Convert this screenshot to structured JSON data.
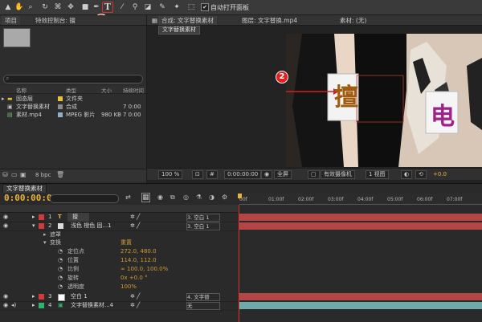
{
  "toolbar": {
    "auto_open_label": "自动打开面板",
    "checkbox_checked": "✔"
  },
  "markers": {
    "m1": "1",
    "m2": "2"
  },
  "project_panel": {
    "tab_project": "项目",
    "tab_effects": "特效控制台: 擅",
    "columns": {
      "name": "名称",
      "type": "类型",
      "size": "大小",
      "duration": "持续时间"
    },
    "items": [
      {
        "name": "固态层",
        "type": "文件夹",
        "size": "",
        "duration": "",
        "color": "#e6c23a"
      },
      {
        "name": "文字替换素材",
        "type": "合成",
        "size": "",
        "duration": "7 0:00",
        "color": "#8a8a8a"
      },
      {
        "name": "素材.mp4",
        "type": "MPEG 影片",
        "size": "980 KB",
        "duration": "7 0:00",
        "color": "#8fb0c9"
      }
    ],
    "bpc": "8 bpc"
  },
  "viewer": {
    "comp_tab": "合成: 文字替换素材",
    "layer_tab": "图层: 文字替换.mp4",
    "footage_tab": "素材: (无)",
    "subtab": "文字替换素材",
    "card_left": "擅",
    "card_right": "电",
    "zoom": "100 %",
    "resolution": "全屏",
    "camera": "有效摄像机",
    "views": "1 视图",
    "exposure": "+0.0"
  },
  "timeline": {
    "tab": "文字替换素材",
    "timecode": "0:00:00:00",
    "ruler_ticks": [
      "00f",
      "01:00f",
      "02:00f",
      "03:00f",
      "04:00f",
      "05:00f",
      "06:00f",
      "07:00f"
    ],
    "layers": [
      {
        "num": "1",
        "name": "擅",
        "parent": "3. 空白 1",
        "label_color": "#d03a3a",
        "bar_color": "#b44646"
      },
      {
        "num": "2",
        "name": "浅色 橙色 固...1",
        "parent": "3. 空白 1",
        "label_color": "#d03a3a",
        "bar_color": "#b44646"
      }
    ],
    "masks_label": "遮罩",
    "transform_label": "变换",
    "reset_label": "重置",
    "props": [
      {
        "name": "定位点",
        "value": "272.0, 480.0"
      },
      {
        "name": "位置",
        "value": "114.0, 112.0"
      },
      {
        "name": "比例",
        "value": "∞ 100.0, 100.0%"
      },
      {
        "name": "旋转",
        "value": "0x +0.0 °"
      },
      {
        "name": "透明度",
        "value": "100%"
      }
    ],
    "bottom_layers": [
      {
        "num": "3",
        "name": "空白 1",
        "parent": "4. 文字替",
        "label_color": "#d03a3a",
        "bar_color": "#b44646"
      },
      {
        "num": "4",
        "name": "文字替换素材...4",
        "parent": "无",
        "label_color": "#2db36b",
        "bar_color": "#6fa9a9"
      }
    ]
  }
}
